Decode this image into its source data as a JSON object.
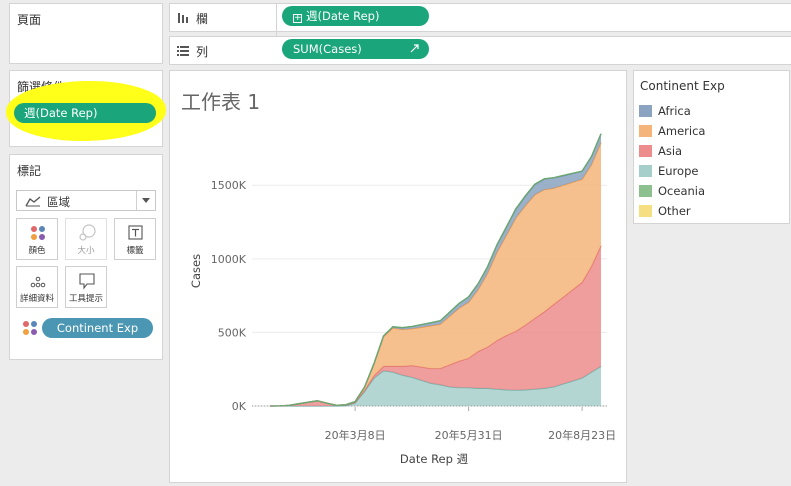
{
  "pages_panel": {
    "title": "頁面"
  },
  "filters_panel": {
    "title": "篩選條件",
    "pill": "週(Date Rep)"
  },
  "marks_panel": {
    "title": "標記",
    "mark_type": "區域",
    "buttons": [
      {
        "label": "顏色",
        "icon": "color-dots-icon"
      },
      {
        "label": "大小",
        "icon": "size-icon"
      },
      {
        "label": "標籤",
        "icon": "label-text-icon"
      },
      {
        "label": "詳細資料",
        "icon": "detail-dots-icon"
      },
      {
        "label": "工具提示",
        "icon": "tooltip-bubble-icon"
      }
    ],
    "color_pill": "Continent Exp"
  },
  "columns_shelf": {
    "label": "欄",
    "pill": "週(Date Rep)"
  },
  "rows_shelf": {
    "label": "列",
    "pill": "SUM(Cases)"
  },
  "worksheet": {
    "title": "工作表 1"
  },
  "legend": {
    "title": "Continent Exp",
    "items": [
      {
        "name": "Africa",
        "color": "#8aa3c0"
      },
      {
        "name": "America",
        "color": "#f5b57a"
      },
      {
        "name": "Asia",
        "color": "#ec8c8c"
      },
      {
        "name": "Europe",
        "color": "#a6cfcb"
      },
      {
        "name": "Oceania",
        "color": "#8cc08e"
      },
      {
        "name": "Other",
        "color": "#f5df82"
      }
    ]
  },
  "chart_data": {
    "type": "area",
    "stacked": true,
    "xlabel": "Date Rep 週",
    "ylabel": "Cases",
    "x_ticks": [
      "20年3月8日",
      "20年5月31日",
      "20年8月23日"
    ],
    "y_ticks": [
      "0K",
      "500K",
      "1000K",
      "1500K"
    ],
    "ylim": [
      0,
      1950000
    ],
    "grid": true,
    "x": [
      "20年1月5日",
      "20年1月12日",
      "20年1月19日",
      "20年1月26日",
      "20年2月2日",
      "20年2月9日",
      "20年2月16日",
      "20年2月23日",
      "20年3月1日",
      "20年3月8日",
      "20年3月15日",
      "20年3月22日",
      "20年3月29日",
      "20年4月5日",
      "20年4月12日",
      "20年4月19日",
      "20年4月26日",
      "20年5月3日",
      "20年5月10日",
      "20年5月17日",
      "20年5月24日",
      "20年5月31日",
      "20年6月7日",
      "20年6月14日",
      "20年6月21日",
      "20年6月28日",
      "20年7月5日",
      "20年7月12日",
      "20年7月19日",
      "20年7月26日",
      "20年8月2日",
      "20年8月9日",
      "20年8月16日",
      "20年8月23日",
      "20年8月30日",
      "20年9月6日"
    ],
    "series": [
      {
        "name": "Europe",
        "color": "#a6cfcb",
        "line": "#6fb3ad",
        "values": [
          0,
          0,
          0,
          0,
          0,
          0,
          0,
          0,
          2000,
          20000,
          100000,
          190000,
          240000,
          230000,
          210000,
          195000,
          175000,
          155000,
          145000,
          130000,
          125000,
          125000,
          120000,
          120000,
          115000,
          110000,
          108000,
          110000,
          115000,
          120000,
          130000,
          150000,
          170000,
          190000,
          230000,
          270000
        ]
      },
      {
        "name": "Asia",
        "color": "#ec8c8c",
        "line": "#e07070",
        "values": [
          0,
          1000,
          4000,
          15000,
          25000,
          35000,
          20000,
          5000,
          5000,
          5000,
          8000,
          15000,
          30000,
          40000,
          60000,
          80000,
          90000,
          100000,
          110000,
          150000,
          180000,
          200000,
          250000,
          280000,
          330000,
          370000,
          400000,
          440000,
          480000,
          520000,
          560000,
          590000,
          620000,
          650000,
          720000,
          820000
        ]
      },
      {
        "name": "America",
        "color": "#f5b57a",
        "line": "#ee9a4f",
        "values": [
          0,
          0,
          0,
          0,
          0,
          0,
          0,
          0,
          1000,
          5000,
          20000,
          80000,
          200000,
          260000,
          250000,
          250000,
          270000,
          290000,
          300000,
          330000,
          360000,
          380000,
          420000,
          500000,
          600000,
          680000,
          770000,
          810000,
          840000,
          830000,
          790000,
          760000,
          730000,
          700000,
          690000,
          700000
        ]
      },
      {
        "name": "Africa",
        "color": "#8aa3c0",
        "line": "#6b89ac",
        "values": [
          0,
          0,
          0,
          0,
          0,
          0,
          0,
          0,
          0,
          0,
          1000,
          3000,
          5000,
          8000,
          12000,
          15000,
          18000,
          20000,
          24000,
          28000,
          32000,
          36000,
          40000,
          45000,
          50000,
          55000,
          60000,
          65000,
          70000,
          72000,
          70000,
          65000,
          60000,
          55000,
          55000,
          60000
        ]
      },
      {
        "name": "Oceania",
        "color": "#8cc08e",
        "line": "#6aa86c",
        "values": [
          0,
          0,
          0,
          0,
          0,
          0,
          0,
          0,
          0,
          200,
          1000,
          2000,
          2000,
          1000,
          500,
          300,
          200,
          200,
          200,
          200,
          200,
          300,
          500,
          800,
          1500,
          2500,
          3000,
          3500,
          3000,
          2500,
          2000,
          1500,
          1000,
          800,
          500,
          400
        ]
      }
    ]
  }
}
